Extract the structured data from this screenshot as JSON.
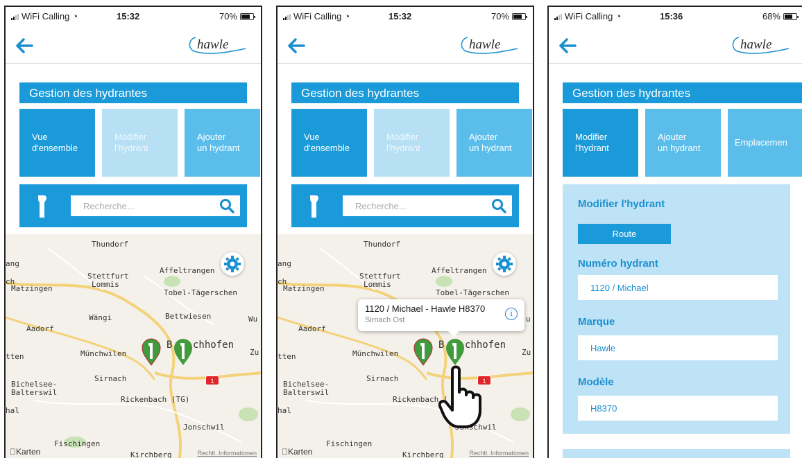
{
  "screens": [
    {
      "status": {
        "carrier": "WiFi Calling",
        "time": "15:32",
        "battery": "70%",
        "battery_level": 0.7
      },
      "header": {
        "logo": "hawle"
      },
      "title": "Gestion des hydrantes",
      "tiles": [
        {
          "line1": "Vue",
          "line2": "d'ensemble"
        },
        {
          "line1": "Modifier",
          "line2": "l'hydrant"
        },
        {
          "line1": "Ajouter",
          "line2": "un hydrant"
        }
      ],
      "search": {
        "placeholder": "Recherche..."
      },
      "map": {
        "places": [
          "Thundorf",
          "Stettfurt",
          "Lommis",
          "Affeltrangen",
          "Tobel-Tägerschen",
          "Matzingen",
          "Wängi",
          "Bettwiesen",
          "Aadorf",
          "Münchwilen",
          "B",
          "chhofen",
          "Sirnach",
          "Bichelsee-",
          "Balterswil",
          "Rickenbach (TG)",
          "Jonschwil",
          "Fischingen",
          "Kirchberg",
          "ang",
          "ch",
          "tten",
          "hal",
          "Wu",
          "Zu"
        ],
        "footer": {
          "brand": "Karten",
          "legal": "Rechtl. Informationen"
        },
        "road_badge": "1"
      }
    },
    {
      "status": {
        "carrier": "WiFi Calling",
        "time": "15:32",
        "battery": "70%",
        "battery_level": 0.7
      },
      "header": {
        "logo": "hawle"
      },
      "title": "Gestion des hydrantes",
      "tiles": [
        {
          "line1": "Vue",
          "line2": "d'ensemble"
        },
        {
          "line1": "Modifier",
          "line2": "l'hydrant"
        },
        {
          "line1": "Ajouter",
          "line2": "un hydrant"
        }
      ],
      "search": {
        "placeholder": "Recherche..."
      },
      "map": {
        "places": [
          "Thundorf",
          "Stettfurt",
          "Lommis",
          "Affeltrangen",
          "Tobel-Tägerschen",
          "Matzingen",
          "Aadorf",
          "Münchwilen",
          "B",
          "chhofen",
          "Sirnach",
          "Bichelsee-",
          "Balterswil",
          "Rickenbach (",
          "Jonschwil",
          "Fischingen",
          "Kirchberg",
          "ang",
          "ch",
          "tten",
          "hal",
          "u",
          "Zu"
        ],
        "callout": {
          "title": "1120 / Michael - Hawle H8370",
          "subtitle": "Sirnach Ost",
          "info": "i"
        },
        "footer": {
          "brand": "Karten",
          "legal": "Rechtl. Informationen"
        },
        "road_badge": "1"
      }
    },
    {
      "status": {
        "carrier": "WiFi Calling",
        "time": "15:36",
        "battery": "68%",
        "battery_level": 0.68
      },
      "header": {
        "logo": "hawle"
      },
      "title": "Gestion des hydrantes",
      "tiles": [
        {
          "line1": "Modifier",
          "line2": "l'hydrant"
        },
        {
          "line1": "Ajouter",
          "line2": "un hydrant"
        },
        {
          "line1": "Emplacemen",
          "line2": ""
        }
      ],
      "form": {
        "title": "Modifier l'hydrant",
        "route_button": "Route",
        "fields": [
          {
            "label": "Numéro hydrant",
            "value": "1120 / Michael"
          },
          {
            "label": "Marque",
            "value": "Hawle"
          },
          {
            "label": "Modèle",
            "value": "H8370"
          }
        ]
      }
    }
  ]
}
